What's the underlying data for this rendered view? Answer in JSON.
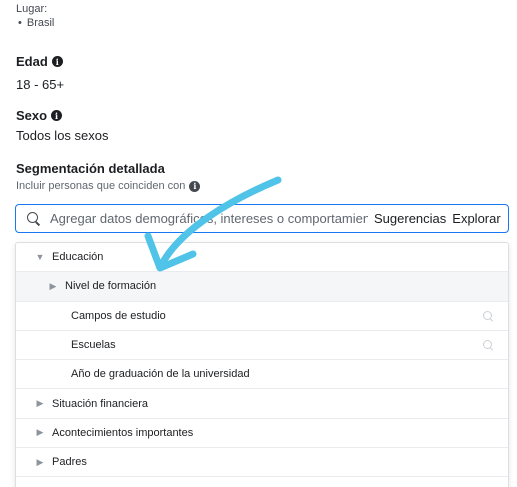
{
  "location": {
    "label": "Lugar:",
    "items": [
      "Brasil"
    ]
  },
  "age": {
    "title": "Edad",
    "value": "18 - 65+"
  },
  "gender": {
    "title": "Sexo",
    "value": "Todos los sexos"
  },
  "detailed": {
    "title": "Segmentación detallada",
    "include_label": "Incluir personas que coinciden con"
  },
  "search": {
    "placeholder": "Agregar datos demográficos, intereses o comportamientos",
    "suggestions_label": "Sugerencias",
    "explore_label": "Explorar"
  },
  "dropdown": {
    "items": [
      {
        "label": "Educación",
        "caret": "▼",
        "indent": 1
      },
      {
        "label": "Nivel de formación",
        "caret": "▶",
        "indent": 2
      },
      {
        "label": "Campos de estudio",
        "caret": "",
        "indent": 3
      },
      {
        "label": "Escuelas",
        "caret": "",
        "indent": 3
      },
      {
        "label": "Año de graduación de la universidad",
        "caret": "",
        "indent": 3
      },
      {
        "label": "Situación financiera",
        "caret": "▶",
        "indent": 1
      },
      {
        "label": "Acontecimientos importantes",
        "caret": "▶",
        "indent": 1
      },
      {
        "label": "Padres",
        "caret": "▶",
        "indent": 1
      }
    ]
  },
  "colors": {
    "accent": "#1877f2",
    "annotation_arrow": "#4fc3e8"
  }
}
